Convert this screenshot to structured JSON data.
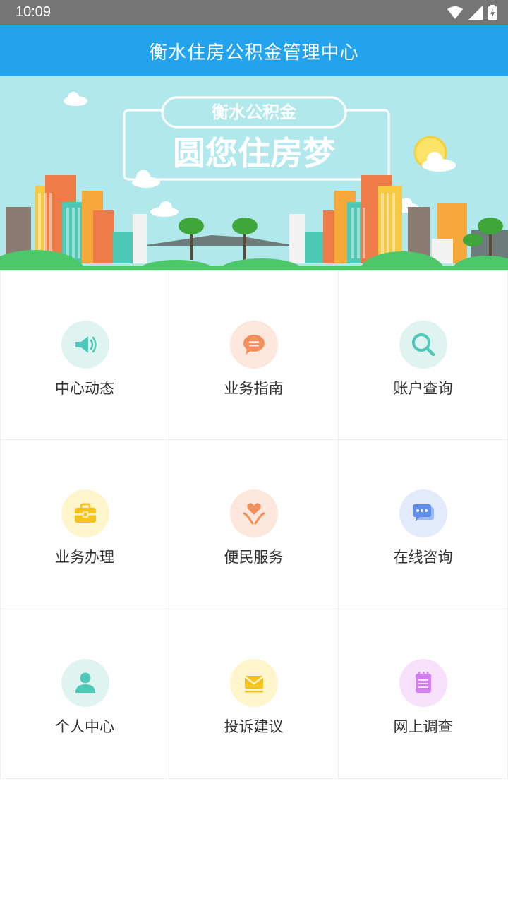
{
  "status_bar": {
    "time": "10:09",
    "icons": [
      "wifi-icon",
      "signal-icon",
      "battery-icon"
    ]
  },
  "app_bar": {
    "title": "衡水住房公积金管理中心"
  },
  "banner": {
    "subtitle": "衡水公积金",
    "headline": "圆您住房梦"
  },
  "menu": {
    "items": [
      {
        "label": "中心动态",
        "icon": "megaphone-icon",
        "bg": "#dff3f1",
        "fg": "#4ec8b7"
      },
      {
        "label": "业务指南",
        "icon": "chat-bubble-icon",
        "bg": "#fde7dd",
        "fg": "#f38f5c"
      },
      {
        "label": "账户查询",
        "icon": "search-icon",
        "bg": "#dff3f1",
        "fg": "#4ec8b7"
      },
      {
        "label": "业务办理",
        "icon": "briefcase-icon",
        "bg": "#fff5cc",
        "fg": "#f6c31e"
      },
      {
        "label": "便民服务",
        "icon": "heart-hands-icon",
        "bg": "#fde7dd",
        "fg": "#f38f5c"
      },
      {
        "label": "在线咨询",
        "icon": "messages-icon",
        "bg": "#e3eafb",
        "fg": "#5f8de8"
      },
      {
        "label": "个人中心",
        "icon": "person-icon",
        "bg": "#dff3f1",
        "fg": "#4ec8b7"
      },
      {
        "label": "投诉建议",
        "icon": "envelope-icon",
        "bg": "#fff5cc",
        "fg": "#f6c31e"
      },
      {
        "label": "网上调查",
        "icon": "notepad-icon",
        "bg": "#f6e0fb",
        "fg": "#d27ef0"
      }
    ]
  }
}
